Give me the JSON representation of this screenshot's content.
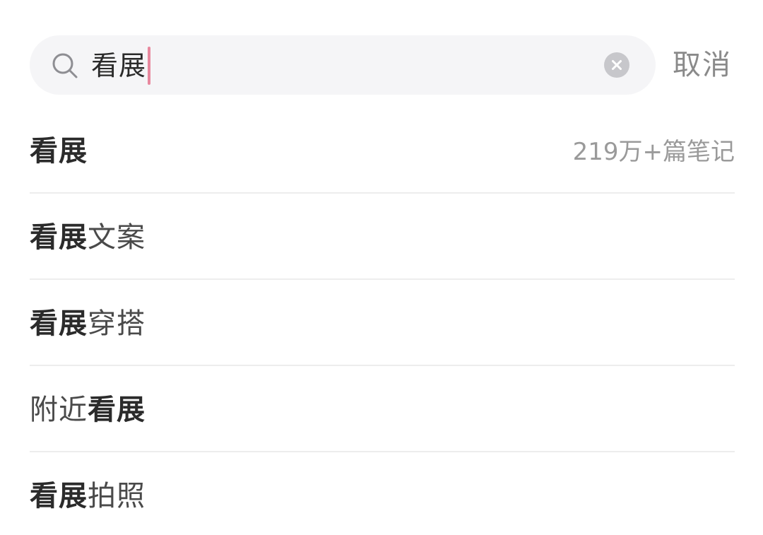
{
  "search": {
    "query": "看展",
    "cancel_label": "取消"
  },
  "colors": {
    "search_bg": "#f5f5f7",
    "caret": "#e8889e",
    "clear_button": "#c7c7cb",
    "divider": "#ededed",
    "muted_text": "#9a9a9a"
  },
  "icons": {
    "search": "search-icon",
    "clear": "clear-icon"
  },
  "suggestions": [
    {
      "before": "",
      "highlight": "看展",
      "after": "",
      "count": "219万+篇笔记"
    },
    {
      "before": "",
      "highlight": "看展",
      "after": "文案"
    },
    {
      "before": "",
      "highlight": "看展",
      "after": "穿搭"
    },
    {
      "before": "附近",
      "highlight": "看展",
      "after": ""
    },
    {
      "before": "",
      "highlight": "看展",
      "after": "拍照"
    }
  ]
}
